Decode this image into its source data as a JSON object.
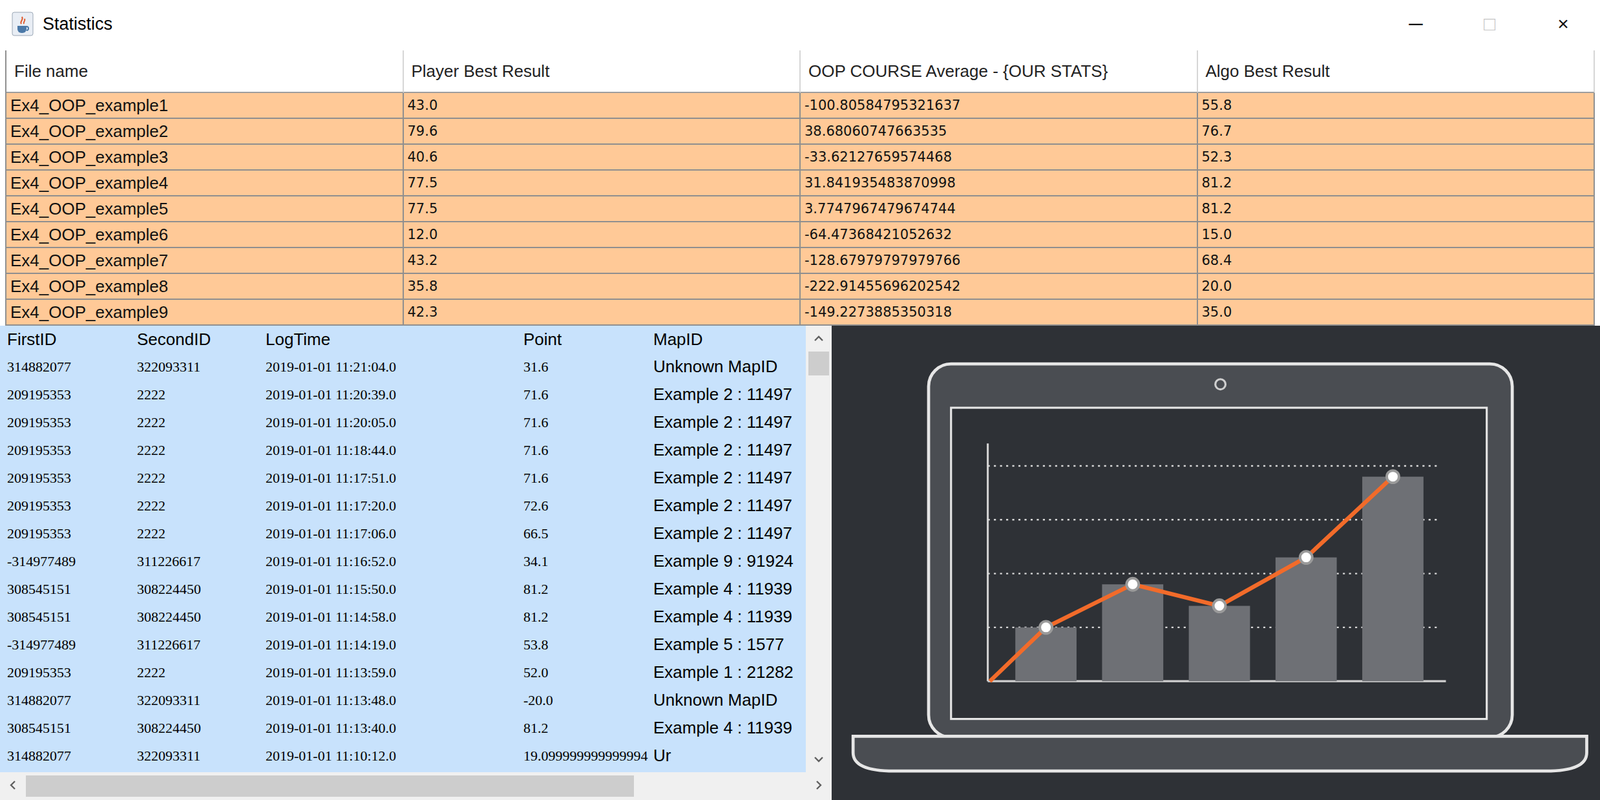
{
  "window": {
    "title": "Statistics",
    "controls": [
      {
        "label": "─",
        "disabled": false
      },
      {
        "label": "□",
        "disabled": true
      },
      {
        "label": "×",
        "disabled": false
      }
    ]
  },
  "summary_table": {
    "columns": [
      "File name",
      "Player Best Result",
      "OOP COURSE Average - {OUR STATS}",
      "Algo Best Result"
    ],
    "rows": [
      {
        "cells": [
          "Ex4_OOP_example1",
          "43.0",
          "-100.80584795321637",
          "55.8"
        ]
      },
      {
        "cells": [
          "Ex4_OOP_example2",
          "79.6",
          "38.68060747663535",
          "76.7"
        ]
      },
      {
        "cells": [
          "Ex4_OOP_example3",
          "40.6",
          "-33.62127659574468",
          "52.3"
        ]
      },
      {
        "cells": [
          "Ex4_OOP_example4",
          "77.5",
          "31.841935483870998",
          "81.2"
        ]
      },
      {
        "cells": [
          "Ex4_OOP_example5",
          "77.5",
          "3.7747967479674744",
          "81.2"
        ]
      },
      {
        "cells": [
          "Ex4_OOP_example6",
          "12.0",
          "-64.47368421052632",
          "15.0"
        ]
      },
      {
        "cells": [
          "Ex4_OOP_example7",
          "43.2",
          "-128.67979797979766",
          "68.4"
        ]
      },
      {
        "cells": [
          "Ex4_OOP_example8",
          "35.8",
          "-222.91455696202542",
          "20.0"
        ]
      },
      {
        "cells": [
          "Ex4_OOP_example9",
          "42.3",
          "-149.2273885350318",
          "35.0"
        ]
      }
    ]
  },
  "log_list": {
    "columns": [
      "FirstID",
      "SecondID",
      "LogTime",
      "Point",
      "MapID"
    ],
    "rows": [
      {
        "cells": [
          "314882077",
          "322093311",
          "2019-01-01 11:21:04.0",
          "31.6",
          "Unknown MapID"
        ]
      },
      {
        "cells": [
          "209195353",
          "2222",
          "2019-01-01 11:20:39.0",
          "71.6",
          "Example 2 : 11497"
        ]
      },
      {
        "cells": [
          "209195353",
          "2222",
          "2019-01-01 11:20:05.0",
          "71.6",
          "Example 2 : 11497"
        ]
      },
      {
        "cells": [
          "209195353",
          "2222",
          "2019-01-01 11:18:44.0",
          "71.6",
          "Example 2 : 11497"
        ]
      },
      {
        "cells": [
          "209195353",
          "2222",
          "2019-01-01 11:17:51.0",
          "71.6",
          "Example 2 : 11497"
        ]
      },
      {
        "cells": [
          "209195353",
          "2222",
          "2019-01-01 11:17:20.0",
          "72.6",
          "Example 2 : 11497"
        ]
      },
      {
        "cells": [
          "209195353",
          "2222",
          "2019-01-01 11:17:06.0",
          "66.5",
          "Example 2 : 11497"
        ]
      },
      {
        "cells": [
          "-314977489",
          "311226617",
          "2019-01-01 11:16:52.0",
          "34.1",
          "Example 9 : 91924"
        ]
      },
      {
        "cells": [
          "308545151",
          "308224450",
          "2019-01-01 11:15:50.0",
          "81.2",
          "Example 4 : 11939"
        ]
      },
      {
        "cells": [
          "308545151",
          "308224450",
          "2019-01-01 11:14:58.0",
          "81.2",
          "Example 4 : 11939"
        ]
      },
      {
        "cells": [
          "-314977489",
          "311226617",
          "2019-01-01 11:14:19.0",
          "53.8",
          "Example 5 : 1577"
        ]
      },
      {
        "cells": [
          "209195353",
          "2222",
          "2019-01-01 11:13:59.0",
          "52.0",
          "Example 1 : 21282"
        ]
      },
      {
        "cells": [
          "314882077",
          "322093311",
          "2019-01-01 11:13:48.0",
          "-20.0",
          "Unknown MapID"
        ]
      },
      {
        "cells": [
          "308545151",
          "308224450",
          "2019-01-01 11:13:40.0",
          "81.2",
          "Example 4 : 11939"
        ]
      },
      {
        "cells": [
          "314882077",
          "322093311",
          "2019-01-01 11:10:12.0",
          "19.099999999999994",
          "Ur"
        ]
      }
    ],
    "vertical_scroll": {
      "level": 0.06
    },
    "horizontal_scroll": {
      "level": 0.78
    }
  },
  "illustration": {
    "gridlines": 4,
    "bars": [
      1.0,
      1.8,
      1.4,
      2.3,
      3.8
    ],
    "line": [
      0,
      1.0,
      1.8,
      1.4,
      2.3,
      3.8
    ]
  }
}
